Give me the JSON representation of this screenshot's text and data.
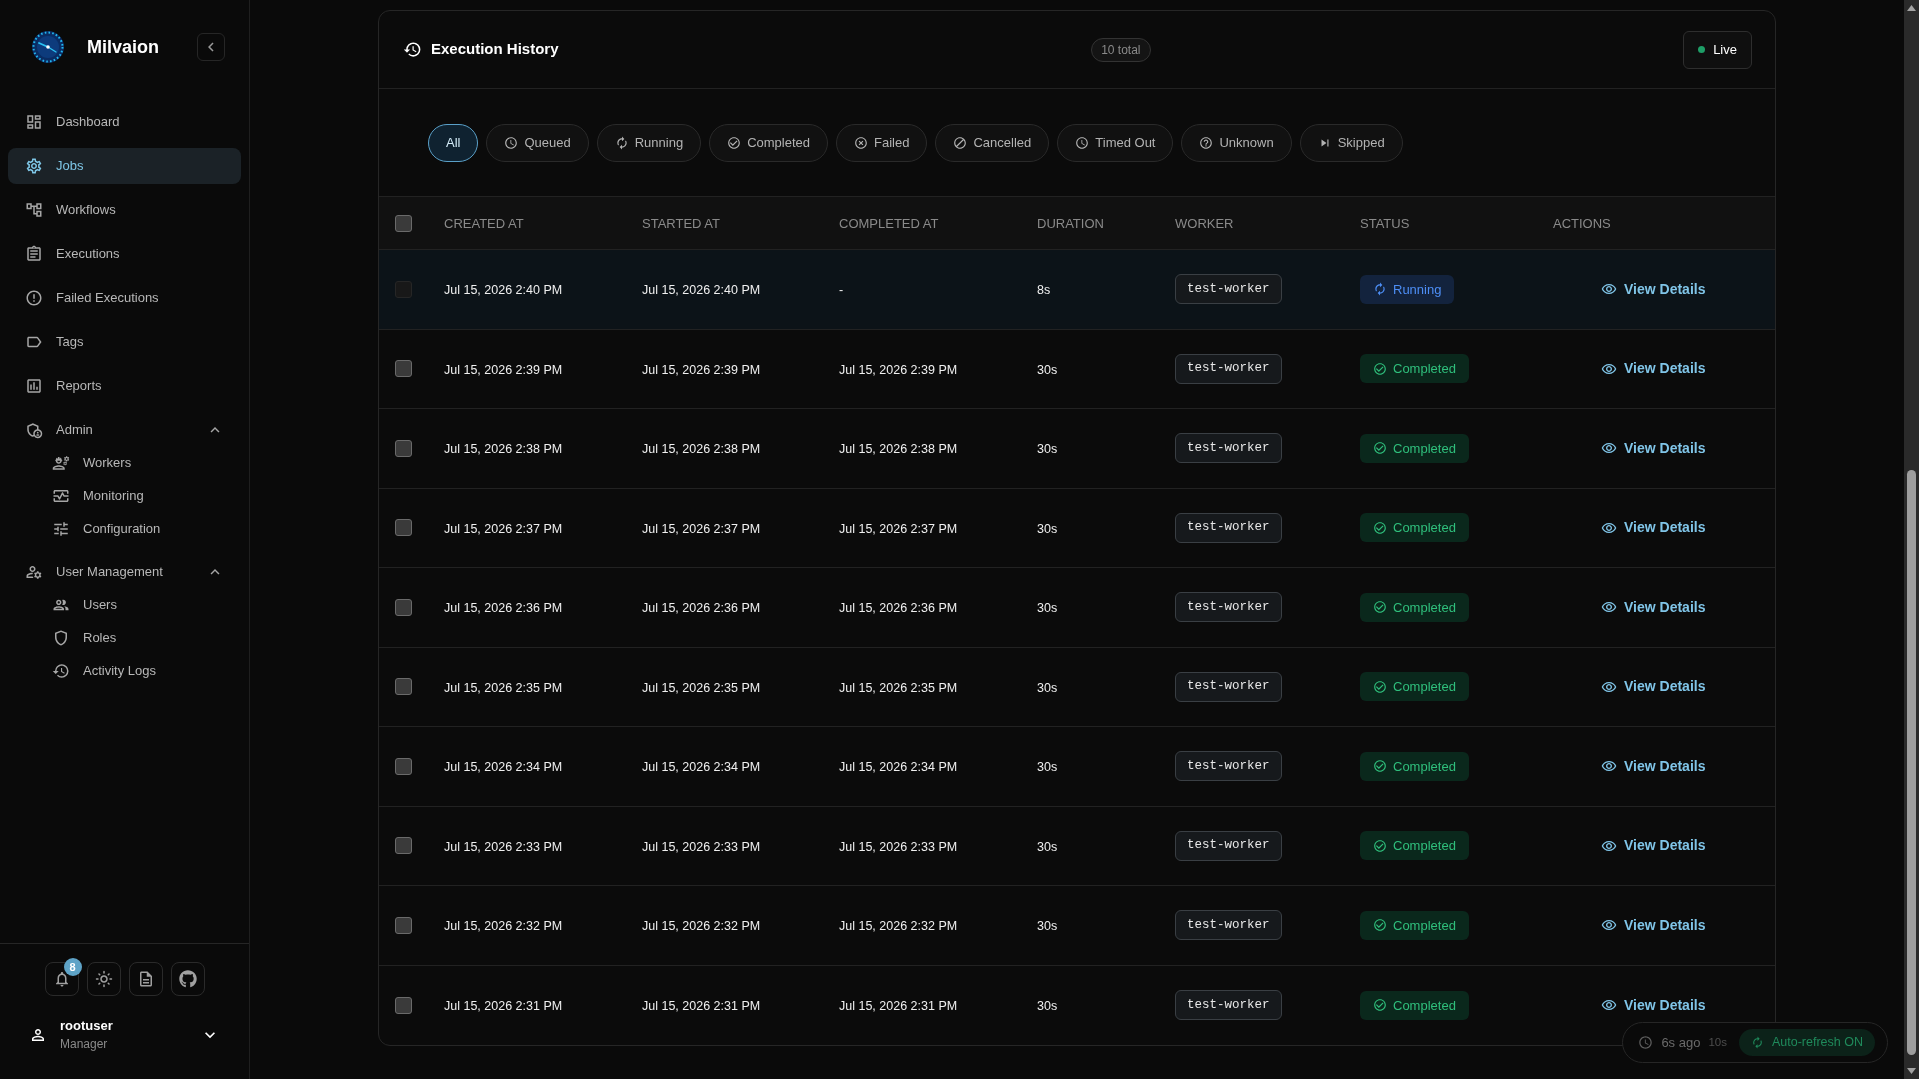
{
  "sidebar": {
    "brand": "Milvaion",
    "nav_items": [
      {
        "label": "Dashboard",
        "selected": false
      },
      {
        "label": "Jobs",
        "selected": true
      },
      {
        "label": "Workflows",
        "selected": false
      },
      {
        "label": "Executions",
        "selected": false
      },
      {
        "label": "Failed Executions",
        "selected": false
      },
      {
        "label": "Tags",
        "selected": false
      },
      {
        "label": "Reports",
        "selected": false
      }
    ],
    "groups": [
      {
        "label": "Admin",
        "expanded": true,
        "children": [
          {
            "label": "Workers",
            "selected": false
          },
          {
            "label": "Monitoring",
            "selected": false
          },
          {
            "label": "Configuration",
            "selected": false
          }
        ]
      },
      {
        "label": "User Management",
        "expanded": true,
        "children": [
          {
            "label": "Users",
            "selected": false
          },
          {
            "label": "Roles",
            "selected": false
          },
          {
            "label": "Activity Logs",
            "selected": false
          }
        ]
      }
    ],
    "notification_count": "8",
    "user": {
      "name": "rootuser",
      "role": "Manager"
    }
  },
  "execution_history": {
    "title": "Execution History",
    "total": "10 total",
    "live": {
      "label": "Live",
      "on": true
    },
    "filters": [
      {
        "label": "All",
        "kind": "all",
        "selected": true
      },
      {
        "label": "Queued",
        "kind": "queued",
        "selected": false
      },
      {
        "label": "Running",
        "kind": "running",
        "selected": false
      },
      {
        "label": "Completed",
        "kind": "completed",
        "selected": false
      },
      {
        "label": "Failed",
        "kind": "failed",
        "selected": false
      },
      {
        "label": "Cancelled",
        "kind": "cancelled",
        "selected": false
      },
      {
        "label": "Timed Out",
        "kind": "timed_out",
        "selected": false
      },
      {
        "label": "Unknown",
        "kind": "unknown",
        "selected": false
      },
      {
        "label": "Skipped",
        "kind": "skipped",
        "selected": false
      }
    ],
    "table": {
      "select_all": {
        "checked": false
      },
      "columns": [
        "CREATED AT",
        "STARTED AT",
        "COMPLETED AT",
        "DURATION",
        "WORKER",
        "STATUS",
        "ACTIONS"
      ],
      "rows": [
        {
          "checkbox": {
            "checked": false,
            "disabled": true
          },
          "created_at": "Jul 15, 2026 2:40 PM",
          "started_at": "Jul 15, 2026 2:40 PM",
          "completed_at": "-",
          "duration": "8s",
          "worker": "test-worker",
          "status": {
            "label": "Running",
            "kind": "running"
          },
          "action": "View Details"
        },
        {
          "checkbox": {
            "checked": false,
            "disabled": false
          },
          "created_at": "Jul 15, 2026 2:39 PM",
          "started_at": "Jul 15, 2026 2:39 PM",
          "completed_at": "Jul 15, 2026 2:39 PM",
          "duration": "30s",
          "worker": "test-worker",
          "status": {
            "label": "Completed",
            "kind": "completed"
          },
          "action": "View Details"
        },
        {
          "checkbox": {
            "checked": false,
            "disabled": false
          },
          "created_at": "Jul 15, 2026 2:38 PM",
          "started_at": "Jul 15, 2026 2:38 PM",
          "completed_at": "Jul 15, 2026 2:38 PM",
          "duration": "30s",
          "worker": "test-worker",
          "status": {
            "label": "Completed",
            "kind": "completed"
          },
          "action": "View Details"
        },
        {
          "checkbox": {
            "checked": false,
            "disabled": false
          },
          "created_at": "Jul 15, 2026 2:37 PM",
          "started_at": "Jul 15, 2026 2:37 PM",
          "completed_at": "Jul 15, 2026 2:37 PM",
          "duration": "30s",
          "worker": "test-worker",
          "status": {
            "label": "Completed",
            "kind": "completed"
          },
          "action": "View Details"
        },
        {
          "checkbox": {
            "checked": false,
            "disabled": false
          },
          "created_at": "Jul 15, 2026 2:36 PM",
          "started_at": "Jul 15, 2026 2:36 PM",
          "completed_at": "Jul 15, 2026 2:36 PM",
          "duration": "30s",
          "worker": "test-worker",
          "status": {
            "label": "Completed",
            "kind": "completed"
          },
          "action": "View Details"
        },
        {
          "checkbox": {
            "checked": false,
            "disabled": false
          },
          "created_at": "Jul 15, 2026 2:35 PM",
          "started_at": "Jul 15, 2026 2:35 PM",
          "completed_at": "Jul 15, 2026 2:35 PM",
          "duration": "30s",
          "worker": "test-worker",
          "status": {
            "label": "Completed",
            "kind": "completed"
          },
          "action": "View Details"
        },
        {
          "checkbox": {
            "checked": false,
            "disabled": false
          },
          "created_at": "Jul 15, 2026 2:34 PM",
          "started_at": "Jul 15, 2026 2:34 PM",
          "completed_at": "Jul 15, 2026 2:34 PM",
          "duration": "30s",
          "worker": "test-worker",
          "status": {
            "label": "Completed",
            "kind": "completed"
          },
          "action": "View Details"
        },
        {
          "checkbox": {
            "checked": false,
            "disabled": false
          },
          "created_at": "Jul 15, 2026 2:33 PM",
          "started_at": "Jul 15, 2026 2:33 PM",
          "completed_at": "Jul 15, 2026 2:33 PM",
          "duration": "30s",
          "worker": "test-worker",
          "status": {
            "label": "Completed",
            "kind": "completed"
          },
          "action": "View Details"
        },
        {
          "checkbox": {
            "checked": false,
            "disabled": false
          },
          "created_at": "Jul 15, 2026 2:32 PM",
          "started_at": "Jul 15, 2026 2:32 PM",
          "completed_at": "Jul 15, 2026 2:32 PM",
          "duration": "30s",
          "worker": "test-worker",
          "status": {
            "label": "Completed",
            "kind": "completed"
          },
          "action": "View Details"
        },
        {
          "checkbox": {
            "checked": false,
            "disabled": false
          },
          "created_at": "Jul 15, 2026 2:31 PM",
          "started_at": "Jul 15, 2026 2:31 PM",
          "completed_at": "Jul 15, 2026 2:31 PM",
          "duration": "30s",
          "worker": "test-worker",
          "status": {
            "label": "Completed",
            "kind": "completed"
          },
          "action": "View Details"
        }
      ]
    }
  },
  "refresh_status": {
    "last_updated": "6s ago",
    "interval": "10s",
    "auto_refresh": {
      "label": "Auto-refresh ON",
      "on": true
    }
  }
}
